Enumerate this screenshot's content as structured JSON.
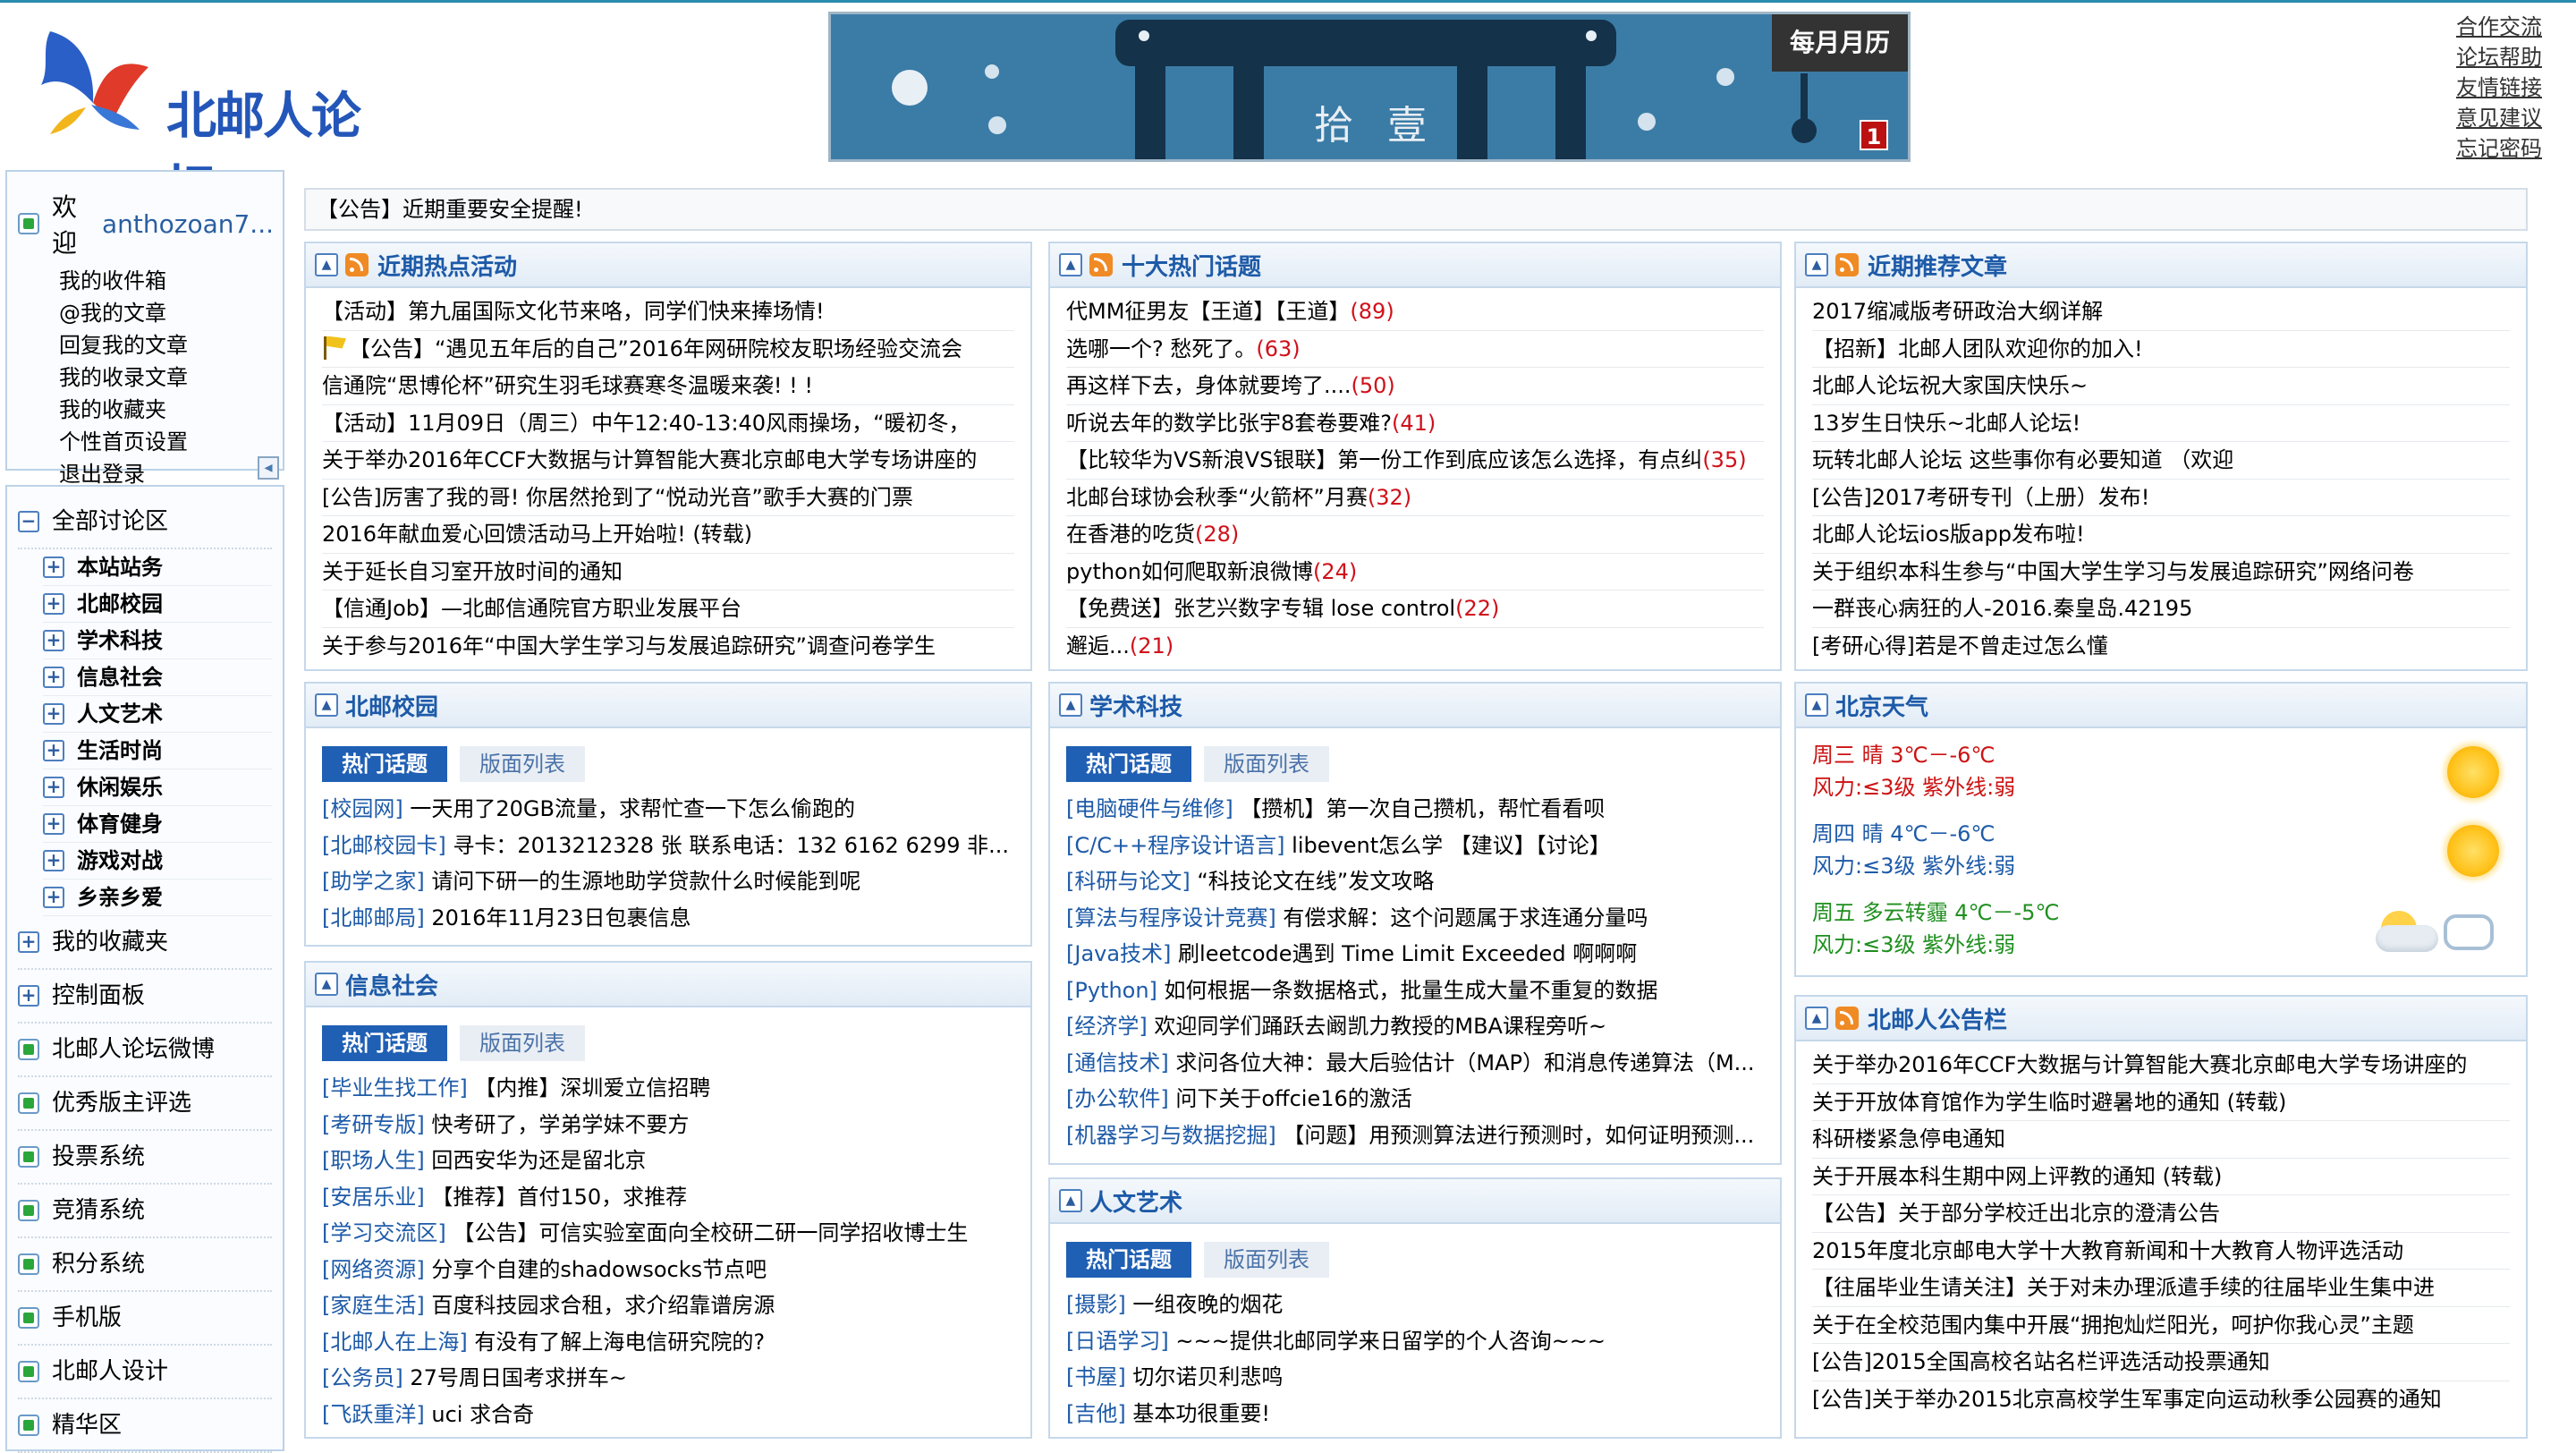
{
  "header": {
    "logo_text": "北邮人论坛",
    "banner_tag": "每月月历",
    "banner_text": "拾 壹",
    "banner_num": "1",
    "links": [
      "合作交流",
      "论坛帮助",
      "友情链接",
      "意见建议",
      "忘记密码"
    ]
  },
  "user": {
    "welcome": "欢迎",
    "username": "anthozoan7...",
    "links": [
      "我的收件箱",
      "@我的文章",
      "回复我的文章",
      "我的收录文章",
      "我的收藏夹",
      "个性首页设置",
      "退出登录"
    ]
  },
  "nav": {
    "all_boards": "全部讨论区",
    "boards": [
      "本站站务",
      "北邮校园",
      "学术科技",
      "信息社会",
      "人文艺术",
      "生活时尚",
      "休闲娱乐",
      "体育健身",
      "游戏对战",
      "乡亲乡爱"
    ],
    "favorites": "我的收藏夹",
    "control": "控制面板",
    "extra": [
      "北邮人论坛微博",
      "优秀版主评选",
      "投票系统",
      "竞猜系统",
      "积分系统",
      "手机版",
      "北邮人设计",
      "精华区"
    ]
  },
  "notice": "【公告】近期重要安全提醒!",
  "hot_activities": {
    "title": "近期热点活动",
    "items": [
      "【活动】第九届国际文化节来咯，同学们快来捧场情!",
      "【公告】“遇见五年后的自己”2016年网研院校友职场经验交流会",
      "信通院“思博伦杯”研究生羽毛球赛寒冬温暖来袭! ! !",
      "【活动】11月09日（周三）中午12:40-13:40风雨操场，“暖初冬，",
      "关于举办2016年CCF大数据与计算智能大赛北京邮电大学专场讲座的",
      "[公告]厉害了我的哥! 你居然抢到了“悦动光音”歌手大赛的门票",
      "2016年献血爱心回馈活动马上开始啦! (转载)",
      "关于延长自习室开放时间的通知",
      "【信通Job】—北邮信通院官方职业发展平台",
      "关于参与2016年“中国大学生学习与发展追踪研究”调查问卷学生"
    ]
  },
  "top_ten": {
    "title": "十大热门话题",
    "items": [
      {
        "text": "代MM征男友【王道】【王道】",
        "count": "(89)"
      },
      {
        "text": "选哪一个? 愁死了。",
        "count": "(63)"
      },
      {
        "text": "再这样下去，身体就要垮了....",
        "count": "(50)"
      },
      {
        "text": "听说去年的数学比张宇8套卷要难?",
        "count": "(41)"
      },
      {
        "text": "【比较华为VS新浪VS银联】第一份工作到底应该怎么选择，有点纠",
        "count": "(35)"
      },
      {
        "text": "北邮台球协会秋季“火箭杯”月赛",
        "count": "(32)"
      },
      {
        "text": "在香港的吃货",
        "count": "(28)"
      },
      {
        "text": "python如何爬取新浪微博",
        "count": "(24)"
      },
      {
        "text": "【免费送】张艺兴数字专辑 lose control",
        "count": "(22)"
      },
      {
        "text": "邂逅...",
        "count": "(21)"
      }
    ]
  },
  "recommended": {
    "title": "近期推荐文章",
    "items": [
      "2017缩减版考研政治大纲详解",
      "【招新】北邮人团队欢迎你的加入!",
      "北邮人论坛祝大家国庆快乐~",
      "13岁生日快乐~北邮人论坛!",
      "玩转北邮人论坛 这些事你有必要知道 （欢迎",
      "[公告]2017考研专刊（上册）发布!",
      "北邮人论坛ios版app发布啦!",
      "关于组织本科生参与“中国大学生学习与发展追踪研究”网络问卷",
      "一群丧心病狂的人-2016.秦皇岛.42195",
      "[考研心得]若是不曾走过怎么懂"
    ]
  },
  "tabs": {
    "hot": "热门话题",
    "list": "版面列表"
  },
  "campus": {
    "title": "北邮校园",
    "items": [
      {
        "board": "[校园网]",
        "text": " 一天用了20GB流量，求帮忙查一下怎么偷跑的"
      },
      {
        "board": "[北邮校园卡]",
        "text": " 寻卡：2013212328 张 联系电话：132 6162 6299 非..."
      },
      {
        "board": "[助学之家]",
        "text": " 请问下研一的生源地助学贷款什么时候能到呢"
      },
      {
        "board": "[北邮邮局]",
        "text": " 2016年11月23日包裹信息"
      }
    ]
  },
  "society": {
    "title": "信息社会",
    "items": [
      {
        "board": "[毕业生找工作]",
        "text": " 【内推】深圳爱立信招聘"
      },
      {
        "board": "[考研专版]",
        "text": " 快考研了，学弟学妹不要方"
      },
      {
        "board": "[职场人生]",
        "text": " 回西安华为还是留北京"
      },
      {
        "board": "[安居乐业]",
        "text": " 【推荐】首付150，求推荐"
      },
      {
        "board": "[学习交流区]",
        "text": " 【公告】可信实验室面向全校研二研一同学招收博士生"
      },
      {
        "board": "[网络资源]",
        "text": " 分享个自建的shadowsocks节点吧"
      },
      {
        "board": "[家庭生活]",
        "text": " 百度科技园求合租，求介绍靠谱房源"
      },
      {
        "board": "[北邮人在上海]",
        "text": " 有没有了解上海电信研究院的?"
      },
      {
        "board": "[公务员]",
        "text": " 27号周日国考求拼车~"
      },
      {
        "board": "[飞跃重洋]",
        "text": " uci 求合奇"
      }
    ]
  },
  "academic": {
    "title": "学术科技",
    "items": [
      {
        "board": "[电脑硬件与维修]",
        "text": " 【攒机】第一次自己攒机，帮忙看看呗"
      },
      {
        "board": "[C/C++程序设计语言]",
        "text": " libevent怎么学 【建议】【讨论】"
      },
      {
        "board": "[科研与论文]",
        "text": " “科技论文在线”发文攻略"
      },
      {
        "board": "[算法与程序设计竞赛]",
        "text": " 有偿求解：这个问题属于求连通分量吗"
      },
      {
        "board": "[Java技术]",
        "text": " 刷leetcode遇到 Time Limit Exceeded 啊啊啊"
      },
      {
        "board": "[Python]",
        "text": " 如何根据一条数据格式，批量生成大量不重复的数据"
      },
      {
        "board": "[经济学]",
        "text": " 欢迎同学们踊跃去阚凯力教授的MBA课程旁听~"
      },
      {
        "board": "[通信技术]",
        "text": " 求问各位大神：最大后验估计（MAP）和消息传递算法（M..."
      },
      {
        "board": "[办公软件]",
        "text": " 问下关于offcie16的激活"
      },
      {
        "board": "[机器学习与数据挖掘]",
        "text": " 【问题】用预测算法进行预测时，如何证明预测..."
      }
    ]
  },
  "arts": {
    "title": "人文艺术",
    "items": [
      {
        "board": "[摄影]",
        "text": " 一组夜晚的烟花"
      },
      {
        "board": "[日语学习]",
        "text": " ~~~提供北邮同学来日留学的个人咨询~~~"
      },
      {
        "board": "[书屋]",
        "text": " 切尔诺贝利悲鸣"
      },
      {
        "board": "[吉他]",
        "text": " 基本功很重要!"
      }
    ]
  },
  "weather": {
    "title": "北京天气",
    "days": [
      {
        "line1": "周三 晴 3℃－-6℃",
        "line2": "风力:≤3级 紫外线:弱",
        "icon": "sunny-icon",
        "color": "#cc1212"
      },
      {
        "line1": "周四 晴 4℃－-6℃",
        "line2": "风力:≤3级 紫外线:弱",
        "icon": "sunny-icon",
        "color": "#1d5aa8"
      },
      {
        "line1": "周五 多云转霾 4℃－-5℃",
        "line2": "风力:≤3级 紫外线:弱",
        "icon": "cloudy-haze-icon",
        "color": "#1f8f1f"
      }
    ]
  },
  "bulletin": {
    "title": "北邮人公告栏",
    "items": [
      "关于举办2016年CCF大数据与计算智能大赛北京邮电大学专场讲座的",
      "关于开放体育馆作为学生临时避暑地的通知 (转载)",
      "科研楼紧急停电通知",
      "关于开展本科生期中网上评教的通知 (转载)",
      "【公告】关于部分学校迁出北京的澄清公告",
      "2015年度北京邮电大学十大教育新闻和十大教育人物评选活动",
      "【往届毕业生请关注】关于对未办理派遣手续的往届毕业生集中进",
      "关于在全校范围内集中开展“拥抱灿烂阳光，呵护你我心灵”主题",
      "[公告]2015全国高校名站名栏评选活动投票通知",
      "[公告]关于举办2015北京高校学生军事定向运动秋季公园赛的通知"
    ]
  }
}
